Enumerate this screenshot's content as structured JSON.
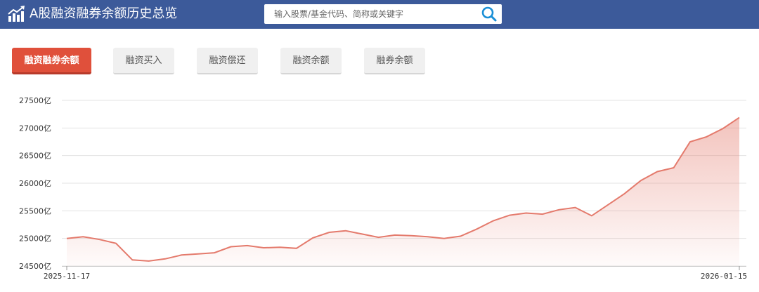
{
  "app": {
    "title": "A股融资融券余额历史总览",
    "logo_icon": "bar-chart-trend-icon"
  },
  "search": {
    "placeholder": "输入股票/基金代码、简称或关键字",
    "value": "",
    "icon": "search-icon"
  },
  "tabs": [
    {
      "label": "融资融券余额",
      "active": true
    },
    {
      "label": "融资买入",
      "active": false
    },
    {
      "label": "融资偿还",
      "active": false
    },
    {
      "label": "融资余额",
      "active": false
    },
    {
      "label": "融券余额",
      "active": false
    }
  ],
  "colors": {
    "header": "#3c5a9a",
    "accent": "#e0503b",
    "line": "#e47a6c"
  },
  "chart_data": {
    "type": "area",
    "unit": "亿",
    "ylim": [
      24500,
      27500
    ],
    "yticks": [
      "27500亿",
      "27000亿",
      "26500亿",
      "26000亿",
      "25500亿",
      "25000亿",
      "24500亿"
    ],
    "yticks_values": [
      27500,
      27000,
      26500,
      26000,
      25500,
      25000,
      24500
    ],
    "x_start_label": "2025-11-17",
    "x_end_label": "2026-01-15",
    "grid": true,
    "values": [
      25000,
      25030,
      24980,
      24910,
      24610,
      24590,
      24630,
      24700,
      24720,
      24740,
      24850,
      24870,
      24830,
      24840,
      24820,
      25010,
      25110,
      25140,
      25080,
      25020,
      25060,
      25050,
      25030,
      25000,
      25040,
      25170,
      25320,
      25420,
      25460,
      25440,
      25520,
      25560,
      25410,
      25610,
      25810,
      26050,
      26210,
      26280,
      26750,
      26840,
      26990,
      27190
    ]
  }
}
